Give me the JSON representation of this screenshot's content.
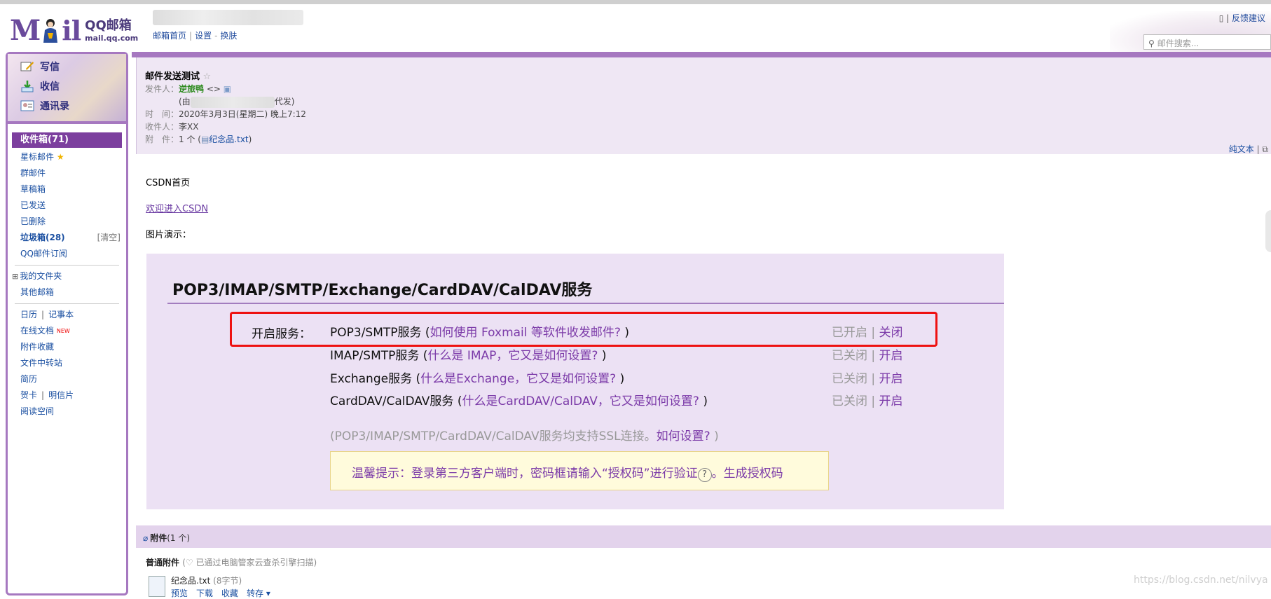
{
  "header": {
    "logo_text": "QQ邮箱",
    "logo_url": "mail.qq.com",
    "links": [
      "邮箱首页",
      "设置",
      "换肤"
    ],
    "feedback": "反馈建议",
    "search_placeholder": "邮件搜索..."
  },
  "sidebar": {
    "actions": [
      {
        "label": "写信",
        "icon": "compose-icon"
      },
      {
        "label": "收信",
        "icon": "receive-icon"
      },
      {
        "label": "通讯录",
        "icon": "contacts-icon"
      }
    ],
    "active_folder": "收件箱(71)",
    "folders": [
      "星标邮件",
      "群邮件",
      "草稿箱",
      "已发送",
      "已删除"
    ],
    "junk": "垃圾箱(28)",
    "junk_clear": "[清空]",
    "subscription": "QQ邮件订阅",
    "my_folders": "我的文件夹",
    "other_mail": "其他邮箱",
    "calendar": "日历",
    "notes": "记事本",
    "online_docs": "在线文档",
    "new_badge": "NEW",
    "tools": [
      "附件收藏",
      "文件中转站",
      "简历"
    ],
    "greeting_card": "贺卡",
    "postcard": "明信片",
    "reading_space": "阅读空间"
  },
  "mail": {
    "subject": "邮件发送测试",
    "sender_label": "发件人：",
    "sender_name": "逆旅鸭",
    "sender_addr": "<>",
    "proxy_prefix": "(由",
    "proxy_suffix": "代发)",
    "time_label": "时　间：",
    "time_value": "2020年3月3日(星期二) 晚上7:12",
    "to_label": "收件人：",
    "to_value": "李XX",
    "attach_label": "附　件：",
    "attach_count": "1 个 (",
    "attach_name": "纪念品.txt",
    "attach_close": ")",
    "plain_text": "纯文本"
  },
  "body": {
    "line1": "CSDN首页",
    "link": "欢迎进入CSDN",
    "line3": "图片演示："
  },
  "embedded_image": {
    "title": "POP3/IMAP/SMTP/Exchange/CardDAV/CalDAV服务",
    "service_label": "开启服务：",
    "services": [
      {
        "name": "POP3/SMTP服务 (",
        "link": "如何使用 Foxmail 等软件收发邮件?",
        "close": " )",
        "status": "已开启",
        "sep": " | ",
        "action": "关闭"
      },
      {
        "name": "IMAP/SMTP服务 (",
        "link": "什么是 IMAP，它又是如何设置?",
        "close": " )",
        "status": "已关闭",
        "sep": " | ",
        "action": "开启"
      },
      {
        "name": "Exchange服务 (",
        "link": "什么是Exchange，它又是如何设置?",
        "close": " )",
        "status": "已关闭",
        "sep": " | ",
        "action": "开启"
      },
      {
        "name": "CardDAV/CalDAV服务 (",
        "link": "什么是CardDAV/CalDAV，它又是如何设置?",
        "close": " )",
        "status": "已关闭",
        "sep": " | ",
        "action": "开启"
      }
    ],
    "ssl_text": "(POP3/IMAP/SMTP/CardDAV/CalDAV服务均支持SSL连接。",
    "ssl_link": "如何设置?",
    "ssl_close": " )",
    "tip_text": "温馨提示：登录第三方客户端时，密码框请输入“授权码”进行验证",
    "tip_q": "?",
    "tip_link": "。生成授权码"
  },
  "attachments": {
    "bar_label": "附件",
    "bar_count": "(1 个)",
    "section": "普通附件",
    "scan_note": "(♡ 已通过电脑管家云查杀引擎扫描)",
    "file_name": "纪念品.txt",
    "file_size": "(8字节)",
    "ops": [
      "预览",
      "下载",
      "收藏",
      "转存 ▾"
    ]
  },
  "watermark": "https://blog.csdn.net/nilvya"
}
